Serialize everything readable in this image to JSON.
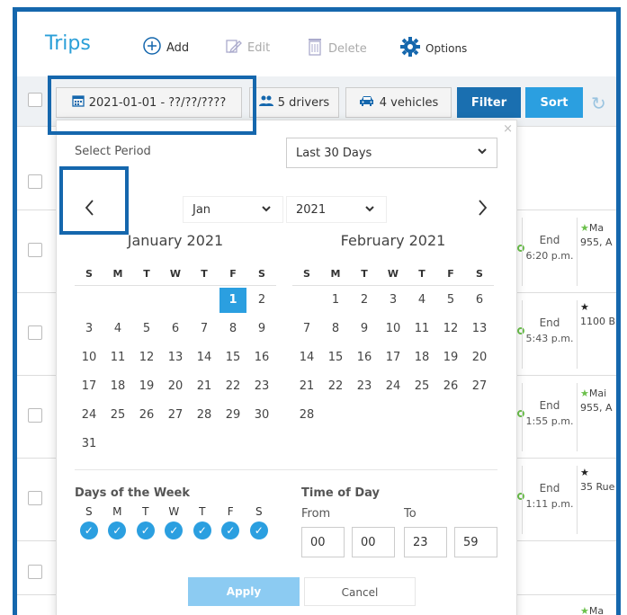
{
  "header": {
    "title": "Trips",
    "add_label": "Add",
    "edit_label": "Edit",
    "delete_label": "Delete",
    "options_label": "Options"
  },
  "toolbar": {
    "date_range": "2021-01-01 - ??/??/????",
    "drivers": "5 drivers",
    "vehicles": "4 vehicles",
    "filter_label": "Filter",
    "sort_label": "Sort"
  },
  "rows": [
    {
      "end_label": "End",
      "end_time": "6:20 p.m.",
      "addr_top": "Ma",
      "addr": "955, A",
      "star": "green"
    },
    {
      "end_label": "End",
      "end_time": "5:43 p.m.",
      "addr_top": "",
      "addr": "1100 B",
      "star": "black"
    },
    {
      "end_label": "End",
      "end_time": "1:55 p.m.",
      "addr_top": "Mai",
      "addr": "955, A",
      "star": "green"
    },
    {
      "end_label": "End",
      "end_time": "1:11 p.m.",
      "addr_top": "",
      "addr": "35 Rue",
      "star": "black"
    },
    {
      "end_label": "",
      "end_time": "",
      "addr_top": "Ma",
      "addr": "",
      "star": "green"
    }
  ],
  "popup": {
    "period_label": "Select Period",
    "period_value": "Last 30 Days",
    "close_glyph": "×",
    "month_value": "Jan",
    "year_value": "2021",
    "cal_left": {
      "title": "January 2021",
      "dow": [
        "S",
        "M",
        "T",
        "W",
        "T",
        "F",
        "S"
      ],
      "days": [
        "",
        "",
        "",
        "",
        "",
        "1",
        "2",
        "3",
        "4",
        "5",
        "6",
        "7",
        "8",
        "9",
        "10",
        "11",
        "12",
        "13",
        "14",
        "15",
        "16",
        "17",
        "18",
        "19",
        "20",
        "21",
        "22",
        "23",
        "24",
        "25",
        "26",
        "27",
        "28",
        "29",
        "30",
        "31"
      ],
      "selected": "1"
    },
    "cal_right": {
      "title": "February 2021",
      "dow": [
        "S",
        "M",
        "T",
        "W",
        "T",
        "F",
        "S"
      ],
      "days": [
        "",
        "1",
        "2",
        "3",
        "4",
        "5",
        "6",
        "7",
        "8",
        "9",
        "10",
        "11",
        "12",
        "13",
        "14",
        "15",
        "16",
        "17",
        "18",
        "19",
        "20",
        "21",
        "22",
        "23",
        "24",
        "25",
        "26",
        "27",
        "28"
      ],
      "selected": ""
    },
    "dow_title": "Days of the Week",
    "dow_letters": [
      "S",
      "M",
      "T",
      "W",
      "T",
      "F",
      "S"
    ],
    "dow_checked": [
      true,
      true,
      true,
      true,
      true,
      true,
      true
    ],
    "tod_title": "Time of Day",
    "from_label": "From",
    "to_label": "To",
    "from_hour": "00",
    "from_min": "00",
    "to_hour": "23",
    "to_min": "59",
    "apply_label": "Apply",
    "cancel_label": "Cancel"
  },
  "colors": {
    "accent": "#2b9fe0",
    "filter_bg": "#1a6fb0",
    "frame": "#1567ad",
    "apply_disabled": "#8ccbf2"
  }
}
